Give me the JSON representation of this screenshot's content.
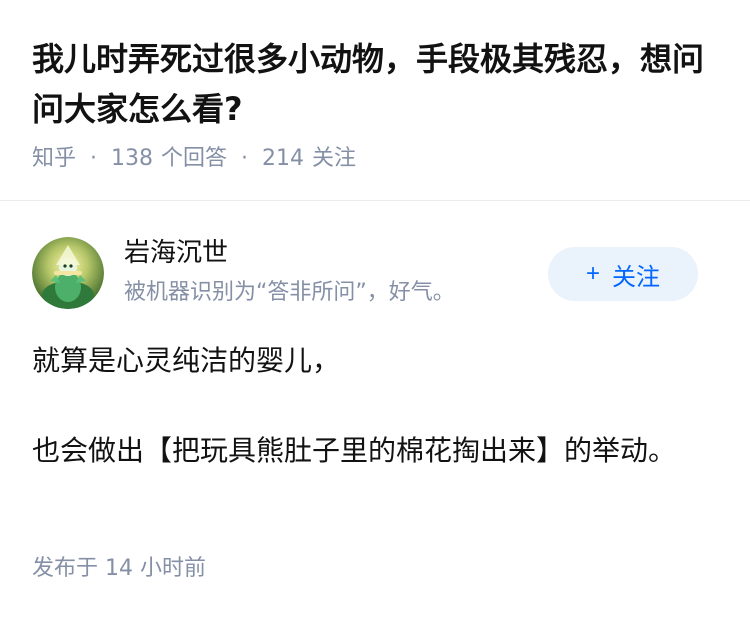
{
  "question": {
    "title": "我儿时弄死过很多小动物，手段极其残忍，想问问大家怎么看?"
  },
  "meta": {
    "source": "知乎",
    "separator": "·",
    "answer_count": "138",
    "answer_label": "个回答",
    "follower_count": "214",
    "follower_label": "关注"
  },
  "author": {
    "name": "岩海沉世",
    "tagline": "被机器识别为“答非所问”，好气。",
    "avatar_icon": "green-character-avatar"
  },
  "follow": {
    "plus": "+",
    "label": "关注",
    "color": "#0066ff",
    "background": "#eaf2fb"
  },
  "answer": {
    "paragraphs": [
      "就算是心灵纯洁的婴儿，",
      "也会做出【把玩具熊肚子里的棉花掏出来】的举动。"
    ]
  },
  "footer": {
    "published_label": "发布于",
    "published_time": "14 小时前"
  }
}
